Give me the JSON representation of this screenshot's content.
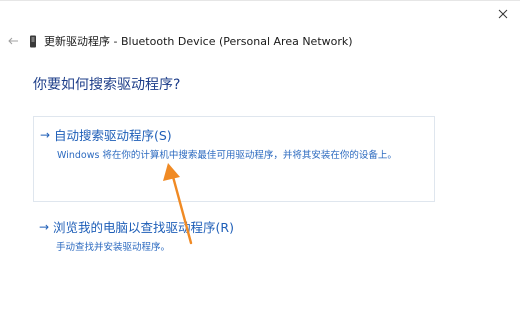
{
  "window": {
    "title": "更新驱动程序 - Bluetooth Device (Personal Area Network)"
  },
  "question": "你要如何搜索驱动程序?",
  "options": [
    {
      "arrow": "→",
      "title": "自动搜索驱动程序(S)",
      "description": "Windows 将在你的计算机中搜索最佳可用驱动程序，并将其安装在你的设备上。"
    },
    {
      "arrow": "→",
      "title": "浏览我的电脑以查找驱动程序(R)",
      "description": "手动查找并安装驱动程序。"
    }
  ],
  "colors": {
    "accent": "#1f5fb8",
    "question": "#1f3f8a",
    "annotation": "#f08a24"
  },
  "icons": {
    "back": "back-arrow-icon",
    "device": "device-icon",
    "close": "close-icon",
    "annotation": "annotation-arrow-icon"
  }
}
